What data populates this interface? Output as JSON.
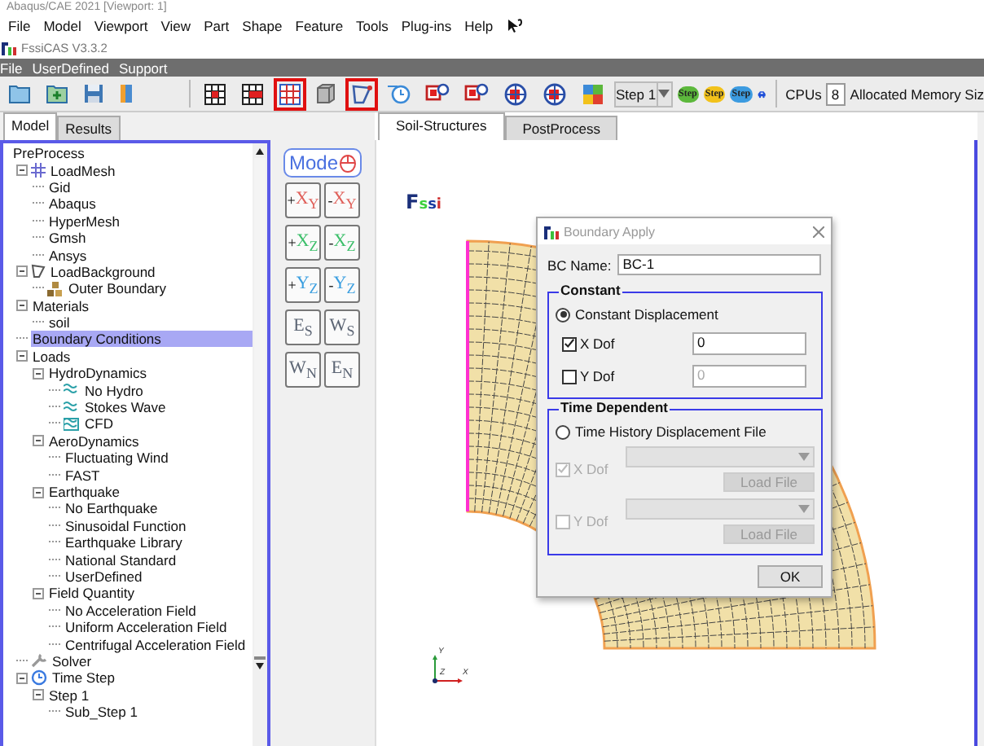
{
  "app_title": "Abaqus/CAE 2021 [Viewport: 1]",
  "host_menu": [
    "File",
    "Model",
    "Viewport",
    "View",
    "Part",
    "Shape",
    "Feature",
    "Tools",
    "Plug-ins",
    "Help"
  ],
  "window": {
    "title": "FssiCAS V3.3.2"
  },
  "menu": [
    "File",
    "UserDefined",
    "Support"
  ],
  "toolbar": {
    "tools": [
      {
        "kind": "open",
        "highlighted": false
      },
      {
        "kind": "add",
        "highlighted": false
      },
      {
        "kind": "save",
        "highlighted": false
      },
      {
        "kind": "book",
        "highlighted": false
      },
      {
        "kind": "grid-dot",
        "highlighted": false
      },
      {
        "kind": "grid-dots",
        "highlighted": false
      },
      {
        "kind": "grid",
        "highlighted": true
      },
      {
        "kind": "cube",
        "highlighted": false
      },
      {
        "kind": "polygon",
        "highlighted": true
      },
      {
        "kind": "clock",
        "highlighted": false
      },
      {
        "kind": "shape",
        "highlighted": false
      },
      {
        "kind": "shape",
        "highlighted": false
      },
      {
        "kind": "ring",
        "highlighted": false
      },
      {
        "kind": "ring",
        "highlighted": false
      },
      {
        "kind": "palette",
        "highlighted": false
      }
    ],
    "step": "Step 1",
    "step_tools": [
      {
        "label": "Step",
        "color": "#5cb83c"
      },
      {
        "label": "Step",
        "color": "#f2c21b"
      },
      {
        "label": "Step",
        "color": "#3c9be0"
      }
    ],
    "cpus_label": "CPUs",
    "cpus": "8",
    "memory_label": "Allocated Memory Siz"
  },
  "tree": {
    "tabs": [
      {
        "label": "Model",
        "selected": true
      },
      {
        "label": "Results",
        "selected": false
      }
    ],
    "nodes": [
      {
        "label": "PreProcess",
        "selected": false,
        "children": [
          {
            "label": "LoadMesh",
            "kind": "mesh",
            "selected": false,
            "expanded": true,
            "children": [
              {
                "label": "Gid",
                "kind": "text",
                "selected": false
              },
              {
                "label": "Abaqus",
                "kind": "text",
                "selected": false
              },
              {
                "label": "HyperMesh",
                "kind": "text",
                "selected": false
              },
              {
                "label": "Gmsh",
                "kind": "text",
                "selected": false
              },
              {
                "label": "Ansys",
                "kind": "text",
                "selected": false
              }
            ]
          },
          {
            "label": "LoadBackground",
            "kind": "background",
            "selected": false,
            "expanded": true,
            "children": [
              {
                "label": "Outer Boundary",
                "kind": "boundary",
                "selected": false
              }
            ]
          },
          {
            "label": "Materials",
            "kind": "text",
            "selected": false,
            "expanded": true,
            "children": [
              {
                "label": "soil",
                "kind": "text",
                "selected": false
              }
            ]
          },
          {
            "label": "Boundary Conditions",
            "kind": "text",
            "selected": true
          },
          {
            "label": "Loads",
            "kind": "text",
            "selected": false,
            "expanded": true,
            "children": [
              {
                "label": "HydroDynamics",
                "kind": "text",
                "selected": false,
                "expanded": true,
                "children": [
                  {
                    "label": "No Hydro",
                    "kind": "hydro",
                    "selected": false
                  },
                  {
                    "label": "Stokes Wave",
                    "kind": "wave",
                    "selected": false
                  },
                  {
                    "label": "CFD",
                    "kind": "cfd",
                    "selected": false
                  }
                ]
              },
              {
                "label": "AeroDynamics",
                "kind": "text",
                "selected": false,
                "expanded": true,
                "children": [
                  {
                    "label": "Fluctuating Wind",
                    "kind": "text",
                    "selected": false
                  },
                  {
                    "label": "FAST",
                    "kind": "text",
                    "selected": false
                  }
                ]
              },
              {
                "label": "Earthquake",
                "kind": "text",
                "selected": false,
                "expanded": true,
                "children": [
                  {
                    "label": "No Earthquake",
                    "kind": "text",
                    "selected": false
                  },
                  {
                    "label": "Sinusoidal Function",
                    "kind": "text",
                    "selected": false
                  },
                  {
                    "label": "Earthquake Library",
                    "kind": "text",
                    "selected": false
                  },
                  {
                    "label": "National Standard",
                    "kind": "text",
                    "selected": false
                  },
                  {
                    "label": "UserDefined",
                    "kind": "text",
                    "selected": false
                  }
                ]
              },
              {
                "label": "Field Quantity",
                "kind": "text",
                "selected": false,
                "expanded": true,
                "children": [
                  {
                    "label": "No Acceleration Field",
                    "kind": "text",
                    "selected": false
                  },
                  {
                    "label": "Uniform Acceleration Field",
                    "kind": "text",
                    "selected": false
                  },
                  {
                    "label": "Centrifugal Acceleration Field",
                    "kind": "text",
                    "selected": false
                  }
                ]
              }
            ]
          },
          {
            "label": "Solver",
            "kind": "solver",
            "selected": false
          },
          {
            "label": "Time Step",
            "kind": "clock",
            "selected": false,
            "expanded": true,
            "children": [
              {
                "label": "Step 1",
                "kind": "text",
                "selected": false,
                "expanded": true,
                "children": [
                  {
                    "label": "Sub_Step 1",
                    "kind": "text",
                    "selected": false
                  }
                ]
              }
            ]
          }
        ]
      }
    ]
  },
  "view_buttons": {
    "mode": "Mode",
    "items": [
      {
        "sign": "+",
        "axes": "X$_{Y}$",
        "color": "#e0605a"
      },
      {
        "sign": "-",
        "axes": "X$_{Y}$",
        "color": "#e0605a"
      },
      {
        "sign": "+",
        "axes": "X$_{Z}$",
        "color": "#3cbf6a"
      },
      {
        "sign": "-",
        "axes": "X$_{Z}$",
        "color": "#3cbf6a"
      },
      {
        "sign": "+",
        "axes": "Y$_{Z}$",
        "color": "#3b9fe0"
      },
      {
        "sign": "-",
        "axes": "Y$_{Z}$",
        "color": "#3b9fe0"
      },
      {
        "axes": "E$_{S}$",
        "color": "#5d6675"
      },
      {
        "axes": "W$_{S}$",
        "color": "#5d6675"
      },
      {
        "axes": "W$_{N}$",
        "color": "#5d6675"
      },
      {
        "axes": "E$_{N}$",
        "color": "#5d6675"
      }
    ]
  },
  "viewport": {
    "tabs": [
      {
        "label": "Soil-Structures",
        "selected": true
      },
      {
        "label": "PostProcess",
        "selected": false
      }
    ],
    "logo": "Fssi",
    "axes": [
      "Y",
      "Z",
      "X"
    ]
  },
  "dialog": {
    "title": "Boundary Apply",
    "name_label": "BC Name:",
    "name_value": "BC-1",
    "groups": [
      {
        "title": "Constant",
        "kind": "constant",
        "option": {
          "label": "Constant Displacement",
          "selected": true
        },
        "dofs": [
          {
            "label": "X Dof",
            "checked": true,
            "disabled": false,
            "value": "0"
          },
          {
            "label": "Y Dof",
            "checked": false,
            "disabled": false,
            "value": "0"
          }
        ]
      },
      {
        "title": "Time Dependent",
        "kind": "file",
        "option": {
          "label": "Time History Displacement File",
          "selected": false
        },
        "dofs": [
          {
            "label": "X Dof",
            "checked": true,
            "disabled": true,
            "button": "Load File"
          },
          {
            "label": "Y Dof",
            "checked": false,
            "disabled": true,
            "button": "Load File"
          }
        ]
      }
    ],
    "ok": "OK"
  }
}
